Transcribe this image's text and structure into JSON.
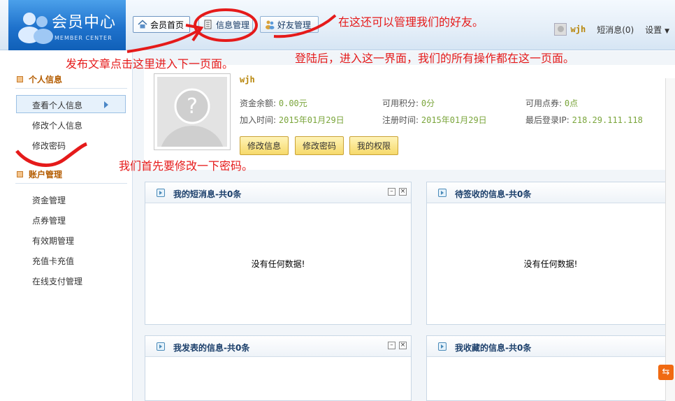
{
  "header": {
    "logo_title": "会员中心",
    "logo_sub": "MEMBER CENTER",
    "tabs": [
      {
        "label": "会员首页",
        "icon": "home-icon",
        "active": true
      },
      {
        "label": "信息管理",
        "icon": "document-icon",
        "active": false
      },
      {
        "label": "好友管理",
        "icon": "friends-icon",
        "active": false
      }
    ],
    "username": "wjh",
    "messages": "短消息(0)",
    "settings": "设置"
  },
  "sidebar": {
    "personal_title": "个人信息",
    "personal_items": [
      "查看个人信息",
      "修改个人信息",
      "修改密码"
    ],
    "account_title": "账户管理",
    "account_items": [
      "资金管理",
      "点券管理",
      "有效期管理",
      "充值卡充值",
      "在线支付管理"
    ]
  },
  "profile": {
    "name": "wjh",
    "balance_label": "资金余额:",
    "balance_value": "0.00元",
    "points_label": "可用积分:",
    "points_value": "0分",
    "coupons_label": "可用点券:",
    "coupons_value": "0点",
    "joined_label": "加入时间:",
    "joined_value": "2015年01月29日",
    "registered_label": "注册时间:",
    "registered_value": "2015年01月29日",
    "lastip_label": "最后登录IP:",
    "lastip_value": "218.29.111.118",
    "buttons": [
      "修改信息",
      "修改密码",
      "我的权限"
    ]
  },
  "panels": [
    {
      "title": "我的短消息-共0条",
      "empty": "没有任何数据!"
    },
    {
      "title": "待签收的信息-共0条",
      "empty": "没有任何数据!"
    },
    {
      "title": "我发表的信息-共0条",
      "empty": ""
    },
    {
      "title": "我收藏的信息-共0条",
      "empty": ""
    }
  ],
  "annotations": {
    "friends": "在这还可以管理我们的好友。",
    "publish": "发布文章点击这里进入下一页面。",
    "login": "登陆后，进入这一界面，我们的所有操作都在这一页面。",
    "password": "我们首先要修改一下密码。"
  },
  "colors": {
    "annotation": "#e51a1a",
    "accent": "#1f72cc",
    "username": "#b8860b",
    "value": "#7aa53b"
  }
}
